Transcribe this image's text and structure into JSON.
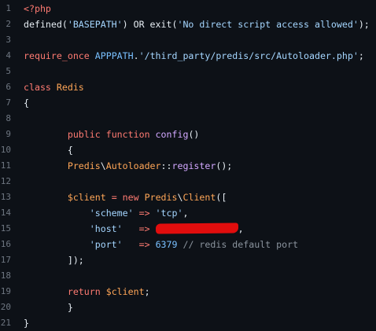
{
  "editor": {
    "lines": [
      {
        "n": "1",
        "t": [
          {
            "c": "kw",
            "v": "<?php"
          }
        ]
      },
      {
        "n": "2",
        "t": [
          {
            "c": "pl",
            "v": "defined("
          },
          {
            "c": "str",
            "v": "'BASEPATH'"
          },
          {
            "c": "pl",
            "v": ") OR exit("
          },
          {
            "c": "str",
            "v": "'No direct script access allowed'"
          },
          {
            "c": "pl",
            "v": ");"
          }
        ]
      },
      {
        "n": "3",
        "t": []
      },
      {
        "n": "4",
        "t": [
          {
            "c": "kw",
            "v": "require_once"
          },
          {
            "c": "pl",
            "v": " "
          },
          {
            "c": "num",
            "v": "APPPATH"
          },
          {
            "c": "pl",
            "v": "."
          },
          {
            "c": "str",
            "v": "'/third_party/predis/src/Autoloader.php'"
          },
          {
            "c": "pl",
            "v": ";"
          }
        ]
      },
      {
        "n": "5",
        "t": []
      },
      {
        "n": "6",
        "t": [
          {
            "c": "kw",
            "v": "class"
          },
          {
            "c": "pl",
            "v": " "
          },
          {
            "c": "cls",
            "v": "Redis"
          }
        ]
      },
      {
        "n": "7",
        "t": [
          {
            "c": "pl",
            "v": "{"
          }
        ]
      },
      {
        "n": "8",
        "t": []
      },
      {
        "n": "9",
        "t": [
          {
            "c": "pl",
            "v": "        "
          },
          {
            "c": "kw",
            "v": "public"
          },
          {
            "c": "pl",
            "v": " "
          },
          {
            "c": "kw",
            "v": "function"
          },
          {
            "c": "pl",
            "v": " "
          },
          {
            "c": "fn",
            "v": "config"
          },
          {
            "c": "pl",
            "v": "()"
          }
        ]
      },
      {
        "n": "10",
        "t": [
          {
            "c": "pl",
            "v": "        {"
          }
        ]
      },
      {
        "n": "11",
        "t": [
          {
            "c": "pl",
            "v": "        "
          },
          {
            "c": "cls",
            "v": "Predis"
          },
          {
            "c": "pl",
            "v": "\\"
          },
          {
            "c": "cls",
            "v": "Autoloader"
          },
          {
            "c": "pl",
            "v": "::"
          },
          {
            "c": "fn",
            "v": "register"
          },
          {
            "c": "pl",
            "v": "();"
          }
        ]
      },
      {
        "n": "12",
        "t": []
      },
      {
        "n": "13",
        "t": [
          {
            "c": "pl",
            "v": "        "
          },
          {
            "c": "var",
            "v": "$client"
          },
          {
            "c": "pl",
            "v": " "
          },
          {
            "c": "kw",
            "v": "="
          },
          {
            "c": "pl",
            "v": " "
          },
          {
            "c": "kw",
            "v": "new"
          },
          {
            "c": "pl",
            "v": " "
          },
          {
            "c": "cls",
            "v": "Predis"
          },
          {
            "c": "pl",
            "v": "\\"
          },
          {
            "c": "cls",
            "v": "Client"
          },
          {
            "c": "pl",
            "v": "(["
          }
        ]
      },
      {
        "n": "14",
        "t": [
          {
            "c": "pl",
            "v": "            "
          },
          {
            "c": "str",
            "v": "'scheme'"
          },
          {
            "c": "pl",
            "v": " "
          },
          {
            "c": "kw",
            "v": "=>"
          },
          {
            "c": "pl",
            "v": " "
          },
          {
            "c": "str",
            "v": "'tcp'"
          },
          {
            "c": "pl",
            "v": ","
          }
        ]
      },
      {
        "n": "15",
        "t": [
          {
            "c": "pl",
            "v": "            "
          },
          {
            "c": "str",
            "v": "'host'"
          },
          {
            "c": "pl",
            "v": "   "
          },
          {
            "c": "kw",
            "v": "=>"
          },
          {
            "c": "pl",
            "v": " "
          },
          {
            "c": "redact",
            "v": ""
          },
          {
            "c": "pl",
            "v": ","
          }
        ]
      },
      {
        "n": "16",
        "t": [
          {
            "c": "pl",
            "v": "            "
          },
          {
            "c": "str",
            "v": "'port'"
          },
          {
            "c": "pl",
            "v": "   "
          },
          {
            "c": "kw",
            "v": "=>"
          },
          {
            "c": "pl",
            "v": " "
          },
          {
            "c": "num",
            "v": "6379"
          },
          {
            "c": "pl",
            "v": " "
          },
          {
            "c": "cm",
            "v": "// redis default port"
          }
        ]
      },
      {
        "n": "17",
        "t": [
          {
            "c": "pl",
            "v": "        ]);"
          }
        ]
      },
      {
        "n": "18",
        "t": []
      },
      {
        "n": "19",
        "t": [
          {
            "c": "pl",
            "v": "        "
          },
          {
            "c": "kw",
            "v": "return"
          },
          {
            "c": "pl",
            "v": " "
          },
          {
            "c": "var",
            "v": "$client"
          },
          {
            "c": "pl",
            "v": ";"
          }
        ]
      },
      {
        "n": "20",
        "t": [
          {
            "c": "pl",
            "v": "        }"
          }
        ]
      },
      {
        "n": "21",
        "t": [
          {
            "c": "pl",
            "v": "}"
          }
        ]
      }
    ]
  },
  "colors": {
    "background": "#0d1117",
    "line_number": "#6e7681",
    "keyword": "#ff7b72",
    "function": "#d2a8ff",
    "string": "#a5d6ff",
    "constant": "#79c0ff",
    "variable": "#ffa657",
    "comment": "#8b949e",
    "redaction": "#e10d0d"
  }
}
